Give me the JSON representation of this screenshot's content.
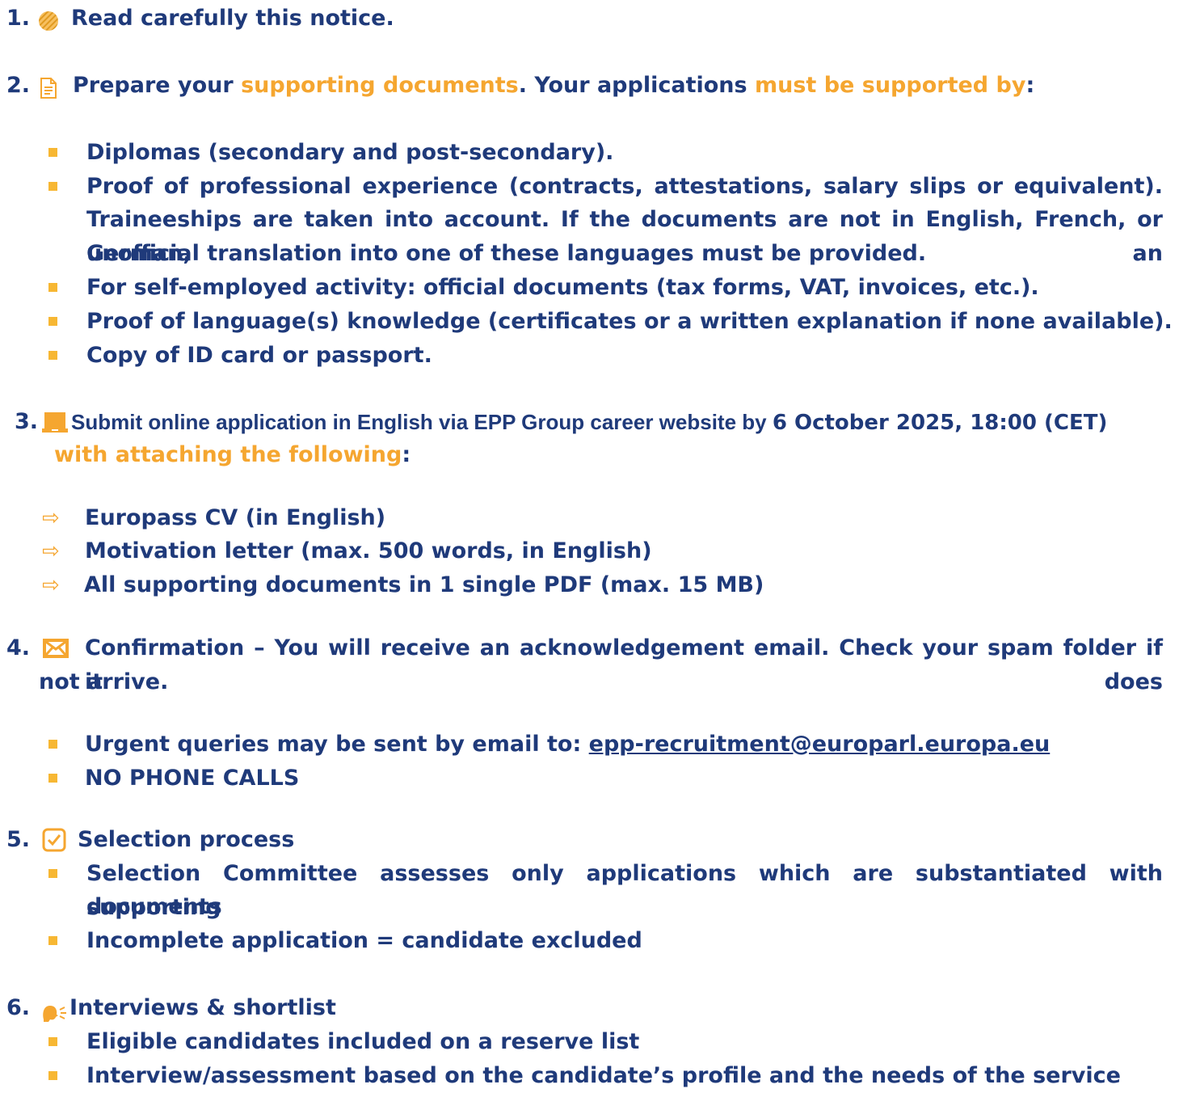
{
  "step1": {
    "num": "1.",
    "text": "Read carefully this notice."
  },
  "step2": {
    "num": "2.",
    "t1": "Prepare your ",
    "h1": "supporting documents",
    "t2": ". Your applications ",
    "h2": "must be supported by",
    "t3": ":",
    "items": [
      "Diplomas (secondary and post-secondary).",
      "Proof of professional experience (contracts, attestations, salary slips or equivalent).",
      "Traineeships are taken into account. If the documents are not in English, French, or German, an",
      "unofficial translation into one of these languages must be provided.",
      "For self-employed activity: official documents (tax forms, VAT, invoices, etc.).",
      "Proof of language(s) knowledge (certificates or a written explanation if none available).",
      "Copy of ID card or passport."
    ]
  },
  "step3": {
    "num": "3.",
    "t1": "Submit online application in English via EPP Group career website by ",
    "deadline": "6 October 2025, 18:00 (CET)",
    "h1": "with attaching the following",
    "t2": ":",
    "items": [
      "Europass CV (in English)",
      "Motivation letter (max. 500 words, in English)",
      "All supporting documents in 1 single PDF (max. 15 MB)"
    ]
  },
  "step4": {
    "num": "4.",
    "line1": "Confirmation – You will receive an acknowledgement email. Check your spam folder if it does",
    "line2": "not arrive.",
    "query_text": "Urgent queries may be sent by email to: ",
    "email": "epp-recruitment@europarl.europa.eu",
    "no_calls": "NO PHONE CALLS"
  },
  "step5": {
    "num": "5.",
    "title": "Selection process",
    "item1a": "Selection Committee assesses only applications which are substantiated with supporting",
    "item1b": "documents",
    "item2": "Incomplete application = candidate excluded"
  },
  "step6": {
    "num": "6.",
    "title": "Interviews & shortlist",
    "items": [
      "Eligible candidates included on a reserve list",
      "Interview/assessment based on the candidate’s profile and the needs of the service"
    ]
  },
  "colors": {
    "text": "#1f3a7a",
    "accent": "#f5a630",
    "bullet": "#f7b733"
  },
  "icons": [
    "striped-circle-icon",
    "document-icon",
    "laptop-icon",
    "envelope-icon",
    "checkbox-icon",
    "speaking-head-icon"
  ]
}
